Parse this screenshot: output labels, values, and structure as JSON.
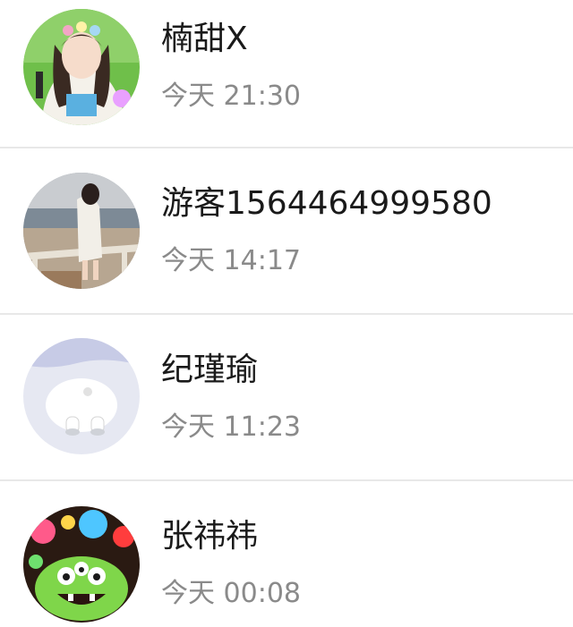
{
  "contacts": [
    {
      "name": "楠甜X",
      "time": "今天 21:30",
      "avatar": "girl-with-flower-crown-avatar"
    },
    {
      "name": "游客1564464999580",
      "time": "今天 14:17",
      "avatar": "girl-on-balcony-avatar"
    },
    {
      "name": "纪瑾瑜",
      "time": "今天 11:23",
      "avatar": "white-bear-avatar"
    },
    {
      "name": "张祎祎",
      "time": "今天 00:08",
      "avatar": "green-monster-avatar"
    }
  ],
  "colors": {
    "name_text": "#1a1a1a",
    "time_text": "#8a8a8a",
    "divider": "#e8e8e8",
    "background": "#ffffff"
  }
}
